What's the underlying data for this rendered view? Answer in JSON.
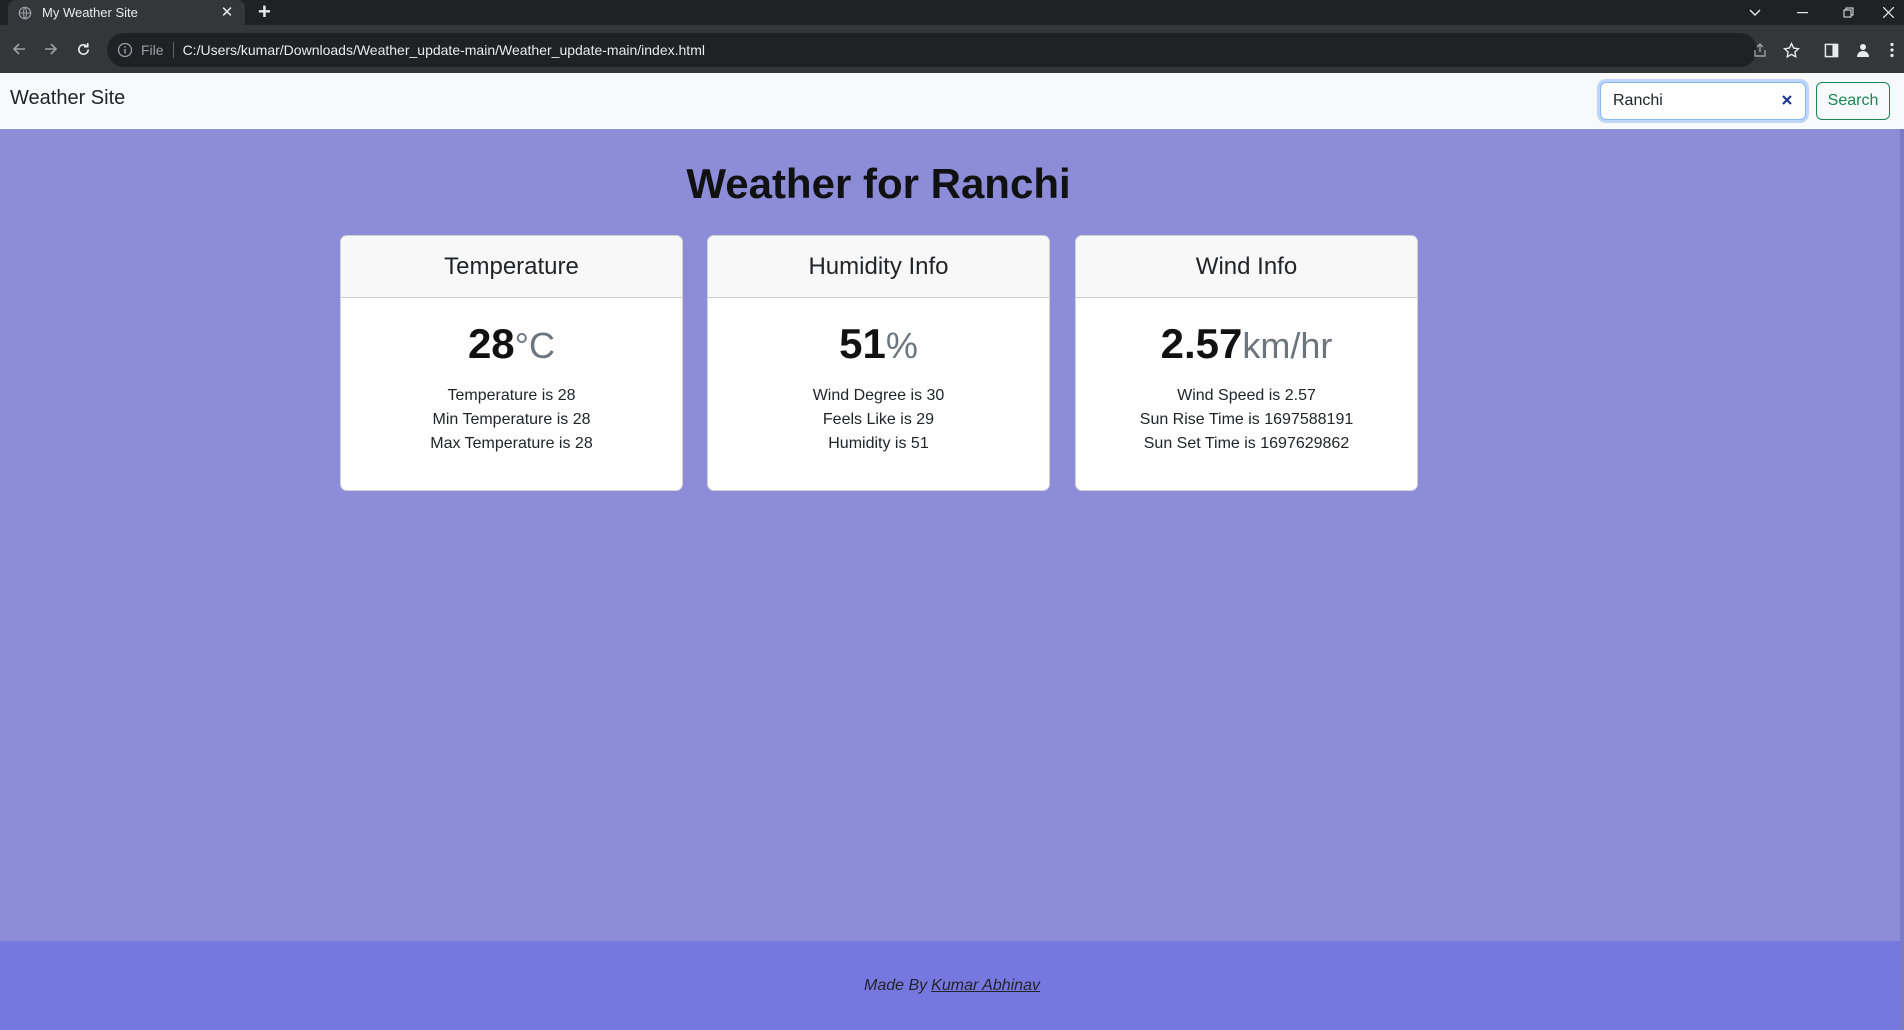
{
  "browser": {
    "tab_title": "My Weather Site",
    "new_tab_symbol": "+",
    "omnibox_scheme_label": "File",
    "url": "C:/Users/kumar/Downloads/Weather_update-main/Weather_update-main/index.html"
  },
  "navbar": {
    "brand": "Weather Site",
    "search_value": "Ranchi",
    "search_button": "Search"
  },
  "heading": "Weather for Ranchi",
  "cards": {
    "temperature": {
      "title": "Temperature",
      "value": "28",
      "unit": "°C",
      "lines": [
        "Temperature is 28",
        "Min Temperature is 28",
        "Max Temperature is 28"
      ]
    },
    "humidity": {
      "title": "Humidity Info",
      "value": "51",
      "unit": "%",
      "lines": [
        "Wind Degree is 30",
        "Feels Like is 29",
        "Humidity is 51"
      ]
    },
    "wind": {
      "title": "Wind Info",
      "value": "2.57",
      "unit": "km/hr",
      "lines": [
        "Wind Speed is 2.57",
        "Sun Rise Time is 1697588191",
        "Sun Set Time is 1697629862"
      ]
    }
  },
  "footer": {
    "prefix": "Made By",
    "author": "Kumar Abhinav"
  },
  "colors": {
    "page_background": "#8c8cd8",
    "footer_background": "#7777e0",
    "search_button": "#198754"
  }
}
